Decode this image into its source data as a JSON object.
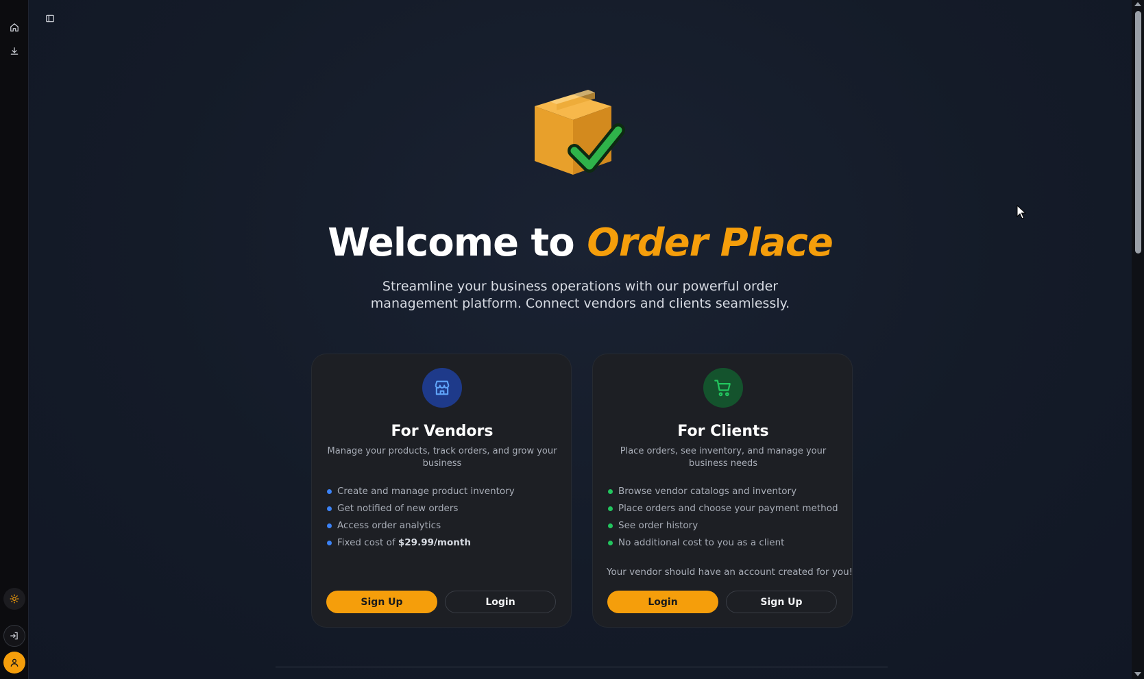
{
  "rail": {
    "top_icons": [
      "home-icon",
      "download-icon"
    ],
    "bottom_icons": [
      "sun-icon",
      "sign-in-icon",
      "user-icon"
    ]
  },
  "hero": {
    "title_prefix": "Welcome to",
    "title_accent": "Order Place",
    "subtitle_line1": "Streamline your business operations with our powerful order",
    "subtitle_line2": "management platform. Connect vendors and clients seamlessly."
  },
  "vendors": {
    "title": "For Vendors",
    "description": "Manage your products, track orders, and grow your business",
    "features": [
      "Create and manage product inventory",
      "Get notified of new orders",
      "Access order analytics"
    ],
    "cost_prefix": "Fixed cost of",
    "cost_value": "$29.99/month",
    "primary_button": "Sign Up",
    "secondary_button": "Login"
  },
  "clients": {
    "title": "For Clients",
    "description": "Place orders, see inventory, and manage your business needs",
    "features": [
      "Browse vendor catalogs and inventory",
      "Place orders and choose your payment method",
      "See order history",
      "No additional cost to you as a client"
    ],
    "note": "Your vendor should have an account created for you!",
    "primary_button": "Login",
    "secondary_button": "Sign Up"
  },
  "colors": {
    "accent": "#f59e0b",
    "vendor_accent": "#3b82f6",
    "client_accent": "#22c55e",
    "background": "#111827",
    "card": "#1d1f24"
  }
}
